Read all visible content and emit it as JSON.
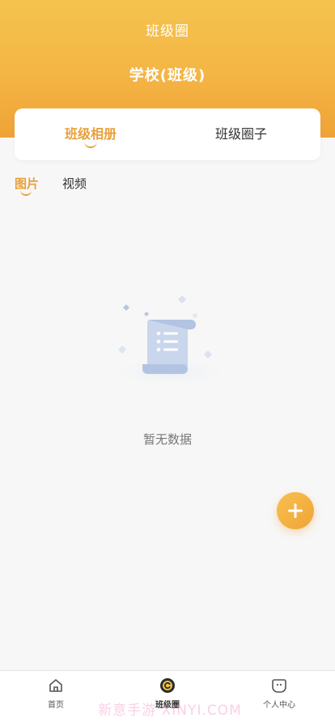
{
  "header": {
    "title": "班级圈",
    "school": "学校(班级)"
  },
  "main_tabs": [
    {
      "label": "班级相册",
      "active": true
    },
    {
      "label": "班级圈子",
      "active": false
    }
  ],
  "sub_tabs": [
    {
      "label": "图片",
      "active": true
    },
    {
      "label": "视频",
      "active": false
    }
  ],
  "empty_state": {
    "text": "暂无数据",
    "icon": "empty-document-icon"
  },
  "fab": {
    "icon": "plus-icon"
  },
  "bottom_nav": [
    {
      "label": "首页",
      "icon": "home-icon",
      "active": false
    },
    {
      "label": "班级圈",
      "icon": "circle-icon",
      "active": true
    },
    {
      "label": "个人中心",
      "icon": "profile-icon",
      "active": false
    }
  ],
  "watermark": "新意手游 XINYI.COM",
  "colors": {
    "accent": "#e8a03a",
    "header_top": "#f5c34e",
    "header_bottom": "#efa236",
    "background": "#f7f7f7"
  }
}
